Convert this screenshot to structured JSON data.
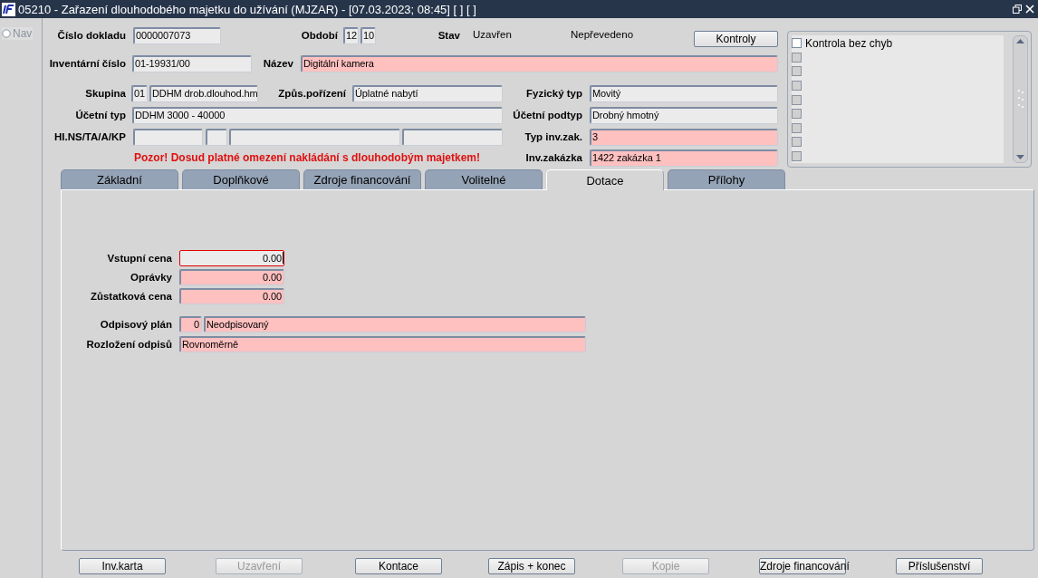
{
  "window": {
    "title": "05210 - Zařazení dlouhodobého majetku do užívání (MJZAR) - [07.03.2023; 08:45] [ ] [ ]"
  },
  "nav": {
    "label": "Nav",
    "selected": false
  },
  "header_rows": [
    [
      {
        "kind": "label",
        "text": "Číslo dokladu"
      },
      {
        "kind": "field",
        "value": "0000007073",
        "highlighted": false
      },
      {
        "kind": "label",
        "text": "Období"
      },
      {
        "kind": "field",
        "value": "12",
        "highlighted": false
      },
      {
        "kind": "field",
        "value": "10",
        "highlighted": false
      },
      {
        "kind": "label",
        "text": "Stav"
      },
      {
        "kind": "text",
        "text": "Uzavřen"
      },
      {
        "kind": "text",
        "text": "Nepřevedeno"
      },
      {
        "kind": "button",
        "label": "Kontroly",
        "disabled": false
      }
    ],
    [
      {
        "kind": "label",
        "text": "Inventární číslo"
      },
      {
        "kind": "field",
        "value": "01-19931/00",
        "highlighted": false
      },
      {
        "kind": "label",
        "text": "Název"
      },
      {
        "kind": "field",
        "value": "Digitální kamera",
        "highlighted": true
      }
    ],
    [
      {
        "kind": "label",
        "text": "Skupina"
      },
      {
        "kind": "field",
        "value": "01",
        "highlighted": false
      },
      {
        "kind": "field",
        "value": "DDHM drob.dlouhod.hm",
        "highlighted": false
      },
      {
        "kind": "label",
        "text": "Způs.pořízení"
      },
      {
        "kind": "field",
        "value": "Úplatné nabytí",
        "highlighted": false
      },
      {
        "kind": "label",
        "text": "Fyzický typ"
      },
      {
        "kind": "field",
        "value": "Movitý",
        "highlighted": false
      }
    ],
    [
      {
        "kind": "label",
        "text": "Účetní typ"
      },
      {
        "kind": "field",
        "value": "DDHM 3000 - 40000",
        "highlighted": false
      },
      {
        "kind": "label",
        "text": "Účetní podtyp"
      },
      {
        "kind": "field",
        "value": "Drobný hmotný",
        "highlighted": false
      }
    ],
    [
      {
        "kind": "label",
        "text": "HI.NS/TA/A/KP"
      },
      {
        "kind": "field",
        "highlighted": false
      },
      {
        "kind": "field",
        "highlighted": false
      },
      {
        "kind": "field",
        "highlighted": false
      },
      {
        "kind": "field",
        "highlighted": false
      },
      {
        "kind": "label",
        "text": "Typ inv.zak."
      },
      {
        "kind": "field",
        "value": "3",
        "highlighted": true
      }
    ],
    [
      {
        "kind": "warning",
        "text": "Pozor! Dosud platné omezení nakládání s dlouhodobým majetkem!"
      },
      {
        "kind": "label",
        "text": "Inv.zakázka"
      },
      {
        "kind": "field",
        "value": "1422 zakázka 1",
        "highlighted": true
      }
    ]
  ],
  "check_list": [
    {
      "label": "Kontrola bez chyb",
      "checked": false,
      "disabled": false
    },
    {
      "checked": false,
      "disabled": true
    },
    {
      "checked": false,
      "disabled": true
    },
    {
      "checked": false,
      "disabled": true
    },
    {
      "checked": false,
      "disabled": true
    },
    {
      "checked": false,
      "disabled": true
    },
    {
      "checked": false,
      "disabled": true
    },
    {
      "checked": false,
      "disabled": true
    },
    {
      "checked": false,
      "disabled": true
    }
  ],
  "tabs": [
    {
      "label": "Základní",
      "selected": false
    },
    {
      "label": "Doplňkové",
      "selected": false
    },
    {
      "label": "Zdroje financování",
      "selected": false
    },
    {
      "label": "Volitelné",
      "selected": false
    },
    {
      "label": "Dotace",
      "selected": true
    },
    {
      "label": "Přílohy",
      "selected": false
    }
  ],
  "dotace_rows": [
    {
      "label": "Vstupní cena",
      "fields": [
        {
          "kind": "amount",
          "value": "0.00",
          "highlighted": false,
          "focused": true
        }
      ]
    },
    {
      "label": "Oprávky",
      "fields": [
        {
          "kind": "amount",
          "value": "0.00",
          "highlighted": true,
          "focused": false
        }
      ]
    },
    {
      "label": "Zůstatková cena",
      "fields": [
        {
          "kind": "amount",
          "value": "0.00",
          "highlighted": true,
          "focused": false
        }
      ]
    },
    {
      "label": "Odpisový plán",
      "fields": [
        {
          "kind": "amount",
          "value": "0",
          "highlighted": true,
          "focused": false
        },
        {
          "kind": "field",
          "value": "Neodpisovaný",
          "highlighted": true,
          "focused": false
        }
      ]
    },
    {
      "label": "Rozložení odpisů",
      "fields": [
        {
          "kind": "field",
          "value": "Rovnoměrně",
          "highlighted": true,
          "focused": false
        }
      ]
    }
  ],
  "buttons": [
    {
      "label": "Inv.karta",
      "disabled": false
    },
    {
      "label": "Uzavření",
      "disabled": true
    },
    {
      "label": "Kontace",
      "disabled": false
    },
    {
      "label": "Zápis + konec",
      "disabled": false
    },
    {
      "label": "Kopie",
      "disabled": true
    },
    {
      "label": "Zdroje financování",
      "disabled": false
    },
    {
      "label": "Příslušenství",
      "disabled": false
    }
  ]
}
